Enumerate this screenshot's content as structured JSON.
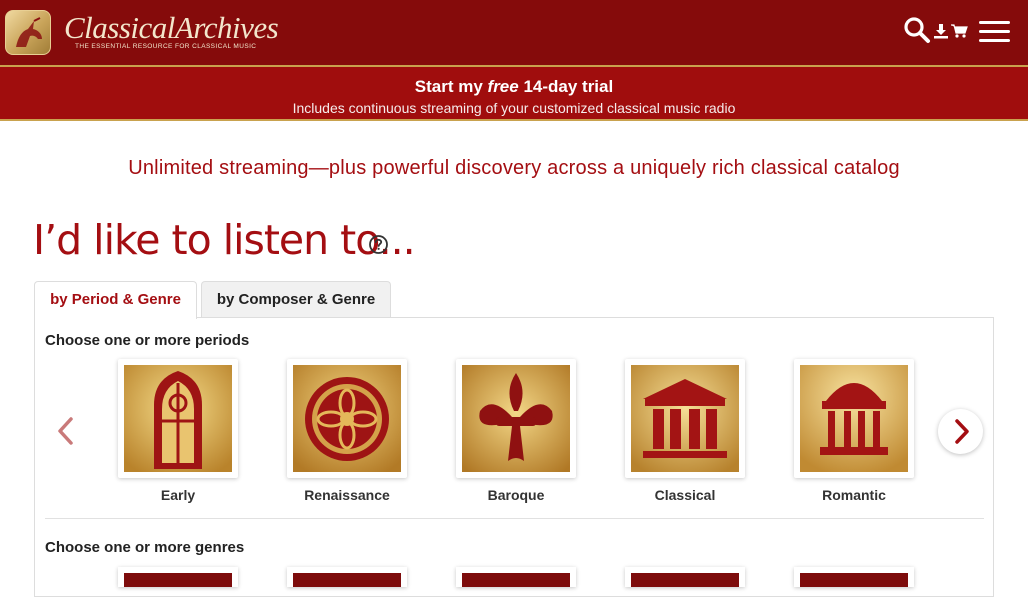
{
  "brand": {
    "name": "ClassicalArchives",
    "tagline": "THE ESSENTIAL RESOURCE FOR CLASSICAL MUSIC"
  },
  "header_icons": [
    "search-icon",
    "download-icon",
    "cart-icon",
    "hamburger-menu-icon"
  ],
  "trial": {
    "title_pre": "Start my ",
    "title_em": "free",
    "title_post": " 14-day trial",
    "subtitle": "Includes continuous streaming of your customized classical music radio"
  },
  "tagline": "Unlimited streaming—plus powerful discovery across a uniquely rich classical catalog",
  "heading": "I’d like to listen to...",
  "tabs": [
    {
      "label": "by Period & Genre",
      "active": true
    },
    {
      "label": "by Composer & Genre",
      "active": false
    }
  ],
  "periods": {
    "label": "Choose one or more periods",
    "items": [
      {
        "label": "Early",
        "icon": "gothic-window-icon"
      },
      {
        "label": "Renaissance",
        "icon": "rose-window-icon"
      },
      {
        "label": "Baroque",
        "icon": "fleur-de-lis-icon"
      },
      {
        "label": "Classical",
        "icon": "temple-icon"
      },
      {
        "label": "Romantic",
        "icon": "gazebo-icon"
      }
    ]
  },
  "genres": {
    "label": "Choose one or more genres"
  },
  "colors": {
    "header": "#850b0b",
    "trial_bar": "#a00d0d",
    "accent": "#a40e12",
    "gold": "#c9a24e"
  }
}
